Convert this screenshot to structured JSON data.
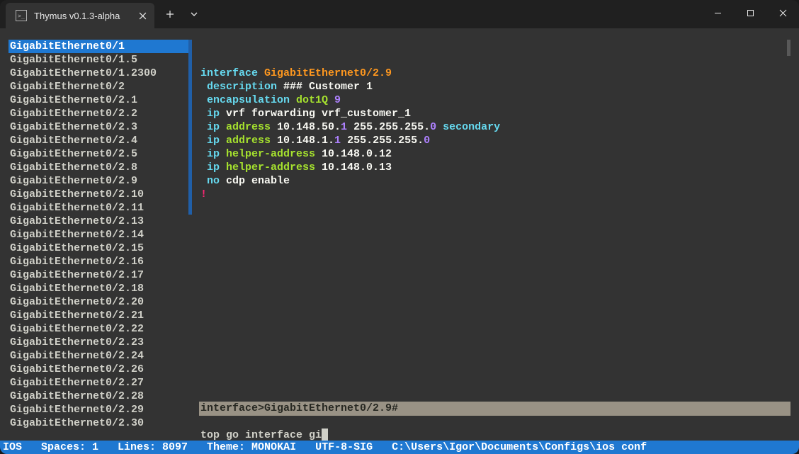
{
  "window": {
    "tab_title": "Thymus v0.1.3-alpha"
  },
  "sidebar": {
    "selected_index": 0,
    "items": [
      "GigabitEthernet0/1",
      "GigabitEthernet0/1.5",
      "GigabitEthernet0/1.2300",
      "GigabitEthernet0/2",
      "GigabitEthernet0/2.1",
      "GigabitEthernet0/2.2",
      "GigabitEthernet0/2.3",
      "GigabitEthernet0/2.4",
      "GigabitEthernet0/2.5",
      "GigabitEthernet0/2.8",
      "GigabitEthernet0/2.9",
      "GigabitEthernet0/2.10",
      "GigabitEthernet0/2.11",
      "GigabitEthernet0/2.13",
      "GigabitEthernet0/2.14",
      "GigabitEthernet0/2.15",
      "GigabitEthernet0/2.16",
      "GigabitEthernet0/2.17",
      "GigabitEthernet0/2.18",
      "GigabitEthernet0/2.20",
      "GigabitEthernet0/2.21",
      "GigabitEthernet0/2.22",
      "GigabitEthernet0/2.23",
      "GigabitEthernet0/2.24",
      "GigabitEthernet0/2.26",
      "GigabitEthernet0/2.27",
      "GigabitEthernet0/2.28",
      "GigabitEthernet0/2.29",
      "GigabitEthernet0/2.30"
    ]
  },
  "editor": {
    "lines": [
      [
        {
          "t": "interface ",
          "c": "k-blue"
        },
        {
          "t": "GigabitEthernet0/2.9",
          "c": "k-orange"
        }
      ],
      [
        {
          "t": " description ",
          "c": "k-blue"
        },
        {
          "t": "### Customer 1",
          "c": "k-white"
        }
      ],
      [
        {
          "t": " encapsulation ",
          "c": "k-blue"
        },
        {
          "t": "dot1Q ",
          "c": "k-green"
        },
        {
          "t": "9",
          "c": "k-purple"
        }
      ],
      [
        {
          "t": " ip ",
          "c": "k-blue"
        },
        {
          "t": "vrf forwarding vrf_customer_1",
          "c": "k-white"
        }
      ],
      [
        {
          "t": " ip ",
          "c": "k-blue"
        },
        {
          "t": "address ",
          "c": "k-green"
        },
        {
          "t": "10.148.50.",
          "c": "k-white"
        },
        {
          "t": "1",
          "c": "k-purple"
        },
        {
          "t": " 255.255.255.",
          "c": "k-white"
        },
        {
          "t": "0",
          "c": "k-purple"
        },
        {
          "t": " secondary",
          "c": "k-blue"
        }
      ],
      [
        {
          "t": " ip ",
          "c": "k-blue"
        },
        {
          "t": "address ",
          "c": "k-green"
        },
        {
          "t": "10.148.1.",
          "c": "k-white"
        },
        {
          "t": "1",
          "c": "k-purple"
        },
        {
          "t": " 255.255.255.",
          "c": "k-white"
        },
        {
          "t": "0",
          "c": "k-purple"
        }
      ],
      [
        {
          "t": " ip ",
          "c": "k-blue"
        },
        {
          "t": "helper-address ",
          "c": "k-green"
        },
        {
          "t": "10.148.0.12",
          "c": "k-white"
        }
      ],
      [
        {
          "t": " ip ",
          "c": "k-blue"
        },
        {
          "t": "helper-address ",
          "c": "k-green"
        },
        {
          "t": "10.148.0.13",
          "c": "k-white"
        }
      ],
      [
        {
          "t": " no ",
          "c": "k-blue"
        },
        {
          "t": "cdp enable",
          "c": "k-white"
        }
      ],
      [
        {
          "t": "!",
          "c": "k-red"
        }
      ]
    ]
  },
  "breadcrumb": "interface>GigabitEthernet0/2.9#",
  "command_input": "top go interface gi",
  "statusbar": {
    "platform": "IOS",
    "spaces_label": "Spaces:",
    "spaces_value": "1",
    "lines_label": "Lines:",
    "lines_value": "8097",
    "theme_label": "Theme:",
    "theme_value": "MONOKAI",
    "encoding": "UTF-8-SIG",
    "filepath": "C:\\Users\\Igor\\Documents\\Configs\\ios conf"
  }
}
